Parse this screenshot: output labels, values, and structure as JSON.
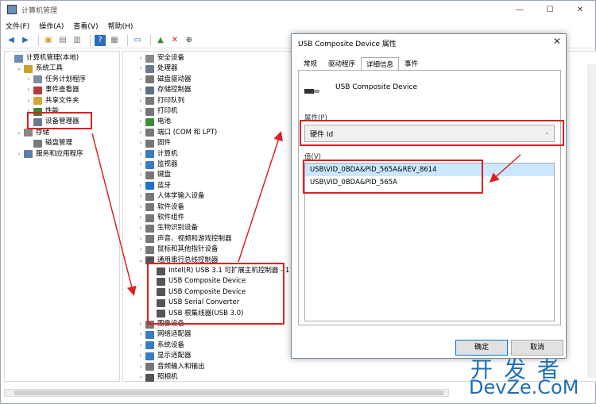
{
  "window": {
    "title": "计算机管理",
    "min": "—",
    "max": "☐",
    "close": "✕"
  },
  "menu": [
    "文件(F)",
    "操作(A)",
    "查看(V)",
    "帮助(H)"
  ],
  "left_tree": [
    {
      "label": "计算机管理(本地)",
      "level": 0,
      "arrow": "",
      "color": "#6b8fb7"
    },
    {
      "label": "系统工具",
      "level": 1,
      "arrow": "⌄",
      "color": "#c9a227"
    },
    {
      "label": "任务计划程序",
      "level": 2,
      "arrow": "›",
      "color": "#7d8ea3"
    },
    {
      "label": "事件查看器",
      "level": 2,
      "arrow": "›",
      "color": "#b33a3a"
    },
    {
      "label": "共享文件夹",
      "level": 2,
      "arrow": "›",
      "color": "#d4a73a"
    },
    {
      "label": "性能",
      "level": 2,
      "arrow": "›",
      "color": "#4a7f3a"
    },
    {
      "label": "设备管理器",
      "level": 2,
      "arrow": "",
      "color": "#6b7a8f"
    },
    {
      "label": "存储",
      "level": 1,
      "arrow": "⌄",
      "color": "#888"
    },
    {
      "label": "磁盘管理",
      "level": 2,
      "arrow": "",
      "color": "#7a7a7a"
    },
    {
      "label": "服务和应用程序",
      "level": 1,
      "arrow": "›",
      "color": "#5a7ea8"
    }
  ],
  "device_tree": [
    {
      "label": "安全设备",
      "level": 0,
      "arrow": "›",
      "color": "#8a8a8a"
    },
    {
      "label": "处理器",
      "level": 0,
      "arrow": "›",
      "color": "#6b7a8f"
    },
    {
      "label": "磁盘驱动器",
      "level": 0,
      "arrow": "›",
      "color": "#777"
    },
    {
      "label": "存储控制器",
      "level": 0,
      "arrow": "›",
      "color": "#5c6f84"
    },
    {
      "label": "打印队列",
      "level": 0,
      "arrow": "›",
      "color": "#777"
    },
    {
      "label": "打印机",
      "level": 0,
      "arrow": "›",
      "color": "#777"
    },
    {
      "label": "电池",
      "level": 0,
      "arrow": "›",
      "color": "#3c8c3c"
    },
    {
      "label": "端口 (COM 和 LPT)",
      "level": 0,
      "arrow": "›",
      "color": "#777"
    },
    {
      "label": "固件",
      "level": 0,
      "arrow": "›",
      "color": "#777"
    },
    {
      "label": "计算机",
      "level": 0,
      "arrow": "›",
      "color": "#3b7bc4"
    },
    {
      "label": "监视器",
      "level": 0,
      "arrow": "›",
      "color": "#3b7bc4"
    },
    {
      "label": "键盘",
      "level": 0,
      "arrow": "›",
      "color": "#777"
    },
    {
      "label": "蓝牙",
      "level": 0,
      "arrow": "›",
      "color": "#1f6fd1"
    },
    {
      "label": "人体学输入设备",
      "level": 0,
      "arrow": "›",
      "color": "#777"
    },
    {
      "label": "软件设备",
      "level": 0,
      "arrow": "›",
      "color": "#777"
    },
    {
      "label": "软件组件",
      "level": 0,
      "arrow": "›",
      "color": "#777"
    },
    {
      "label": "生物识别设备",
      "level": 0,
      "arrow": "›",
      "color": "#777"
    },
    {
      "label": "声音、视频和游戏控制器",
      "level": 0,
      "arrow": "›",
      "color": "#777"
    },
    {
      "label": "鼠标和其他指针设备",
      "level": 0,
      "arrow": "›",
      "color": "#777"
    },
    {
      "label": "通用串行总线控制器",
      "level": 0,
      "arrow": "⌄",
      "color": "#555"
    },
    {
      "label": "Intel(R) USB 3.1 可扩展主机控制器 - 1",
      "level": 1,
      "arrow": "",
      "color": "#555"
    },
    {
      "label": "USB Composite Device",
      "level": 1,
      "arrow": "",
      "color": "#555"
    },
    {
      "label": "USB Composite Device",
      "level": 1,
      "arrow": "",
      "color": "#555"
    },
    {
      "label": "USB Serial Converter",
      "level": 1,
      "arrow": "",
      "color": "#555"
    },
    {
      "label": "USB 根集线器(USB 3.0)",
      "level": 1,
      "arrow": "",
      "color": "#555"
    },
    {
      "label": "图像设备",
      "level": 0,
      "arrow": "›",
      "color": "#777"
    },
    {
      "label": "网络适配器",
      "level": 0,
      "arrow": "›",
      "color": "#3b7bc4"
    },
    {
      "label": "系统设备",
      "level": 0,
      "arrow": "›",
      "color": "#3b7bc4"
    },
    {
      "label": "显示适配器",
      "level": 0,
      "arrow": "›",
      "color": "#3b7bc4"
    },
    {
      "label": "音频输入和输出",
      "level": 0,
      "arrow": "›",
      "color": "#777"
    },
    {
      "label": "照相机",
      "level": 0,
      "arrow": "›",
      "color": "#555"
    }
  ],
  "dialog": {
    "title": "USB Composite Device 属性",
    "close": "✕",
    "tabs": [
      "常规",
      "驱动程序",
      "详细信息",
      "事件"
    ],
    "active_tab": 2,
    "device_name": "USB Composite Device",
    "property_label": "属性(P)",
    "property_value": "硬件 Id",
    "value_label": "值(V)",
    "values": [
      "USB\\VID_0BDA&PID_565A&REV_8614",
      "USB\\VID_0BDA&PID_565A"
    ],
    "ok": "确定",
    "cancel": "取消"
  },
  "watermark": {
    "line1": "开发者",
    "line2": "DevZe.CoM"
  },
  "colors": {
    "highlight": "#e02020",
    "accent": "#0078d7",
    "watermark": "#1e6fb8"
  }
}
